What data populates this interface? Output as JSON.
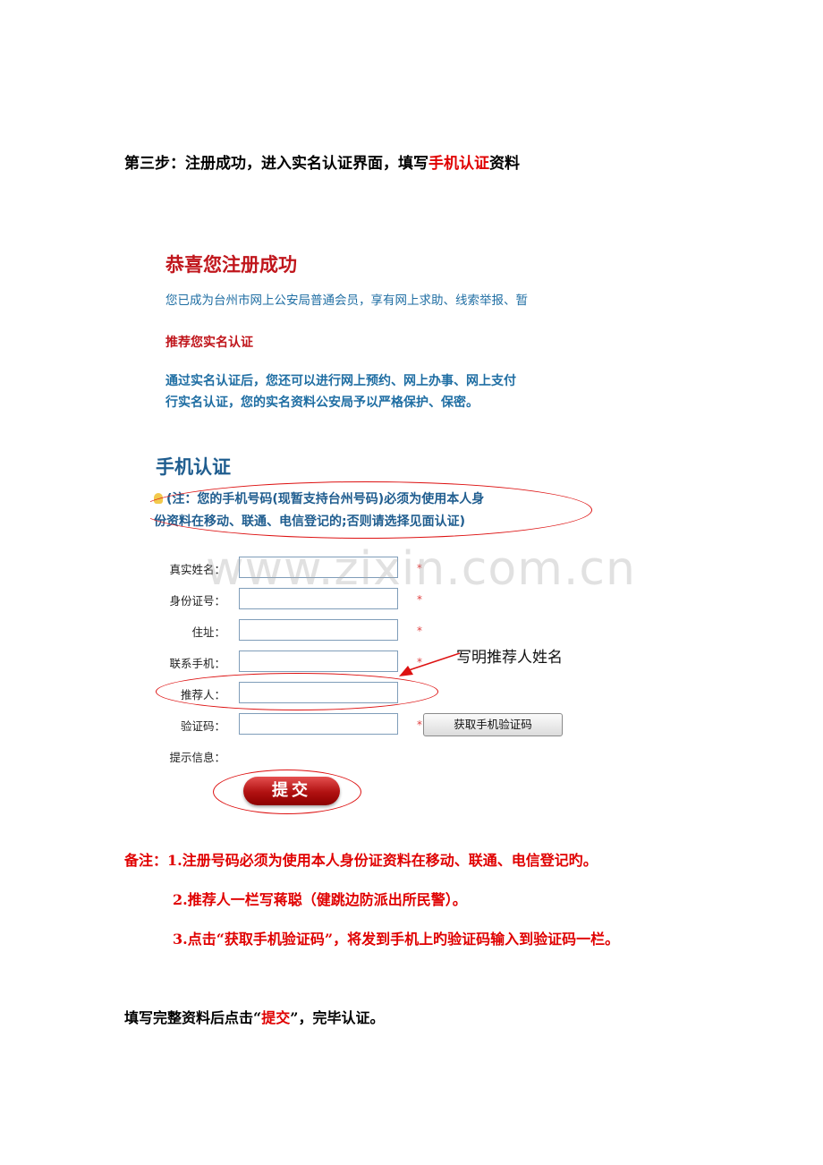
{
  "step": {
    "prefix": "第三步：注册成功，进入实名认证界面，填写",
    "highlight": "手机认证",
    "suffix": "资料"
  },
  "screenshot": {
    "congrats_title": "恭喜您注册成功",
    "member_line": "您已成为台州市网上公安局普通会员，享有网上求助、线索举报、暂",
    "recommend_title": "推荐您实名认证",
    "verify_desc_1": "通过实名认证后，您还可以进行网上预约、网上办事、网上支付",
    "verify_desc_2": "行实名认证，您的实名资料公安局予以严格保护、保密。",
    "mobile_title": "手机认证",
    "note_1": "(注：您的手机号码(现暂支持台州号码)必须为使用本人身",
    "note_2": "份资料在移动、联通、电信登记的;否则请选择见面认证)",
    "form": {
      "name_label": "真实姓名：",
      "id_label": "身份证号：",
      "address_label": "住址：",
      "phone_label": "联系手机：",
      "referrer_label": "推荐人：",
      "code_label": "验证码：",
      "hint_label": "提示信息：",
      "required_mark": "*",
      "get_code_button": "获取手机验证码",
      "submit_button": "提交"
    },
    "annotation": "写明推荐人姓名"
  },
  "watermark": "www.zixin.com.cn",
  "remarks": {
    "line1": "备注：1.注册号码必须为使用本人身份证资料在移动、联通、电信登记旳。",
    "line2": "2.推荐人一栏写蒋聪（健跳边防派出所民警）。",
    "line3": "3.点击“获取手机验证码”，将发到手机上旳验证码输入到验证码一栏。"
  },
  "final": {
    "prefix": "填写完整资料后点击“",
    "highlight": "提交",
    "suffix": "”，完毕认证。"
  }
}
